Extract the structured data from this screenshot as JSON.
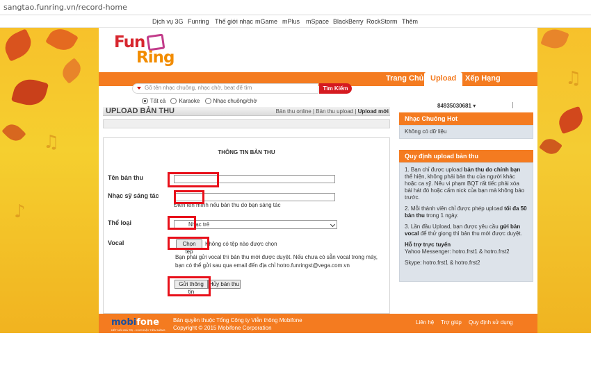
{
  "browser": {
    "url": "sangtao.funring.vn/record-home"
  },
  "topnav": [
    "Dịch vụ 3G",
    "Funring",
    "Thế giới nhạc",
    "mGame",
    "mPlus",
    "mSpace",
    "BlackBerry",
    "RockStorm",
    "Thêm"
  ],
  "logo": {
    "part1": "Fun",
    "part2": "Ring"
  },
  "tabs": {
    "home": "Trang Chủ",
    "upload": "Upload",
    "ranking": "Xếp Hạng"
  },
  "search": {
    "placeholder": "Gõ tên nhạc chuông, nhạc chờ, beat để tìm",
    "button": "Tìm Kiếm"
  },
  "search_filters": {
    "all": "Tất cả",
    "karaoke": "Karaoke",
    "ringtone": "Nhạc chuông/chờ"
  },
  "section": {
    "title": "UPLOAD BẢN THU",
    "links": {
      "online": "Bản thu online",
      "uploaded": "Bản thu upload",
      "newest": "Upload mới"
    },
    "separator": " | "
  },
  "form": {
    "heading": "THÔNG TIN BẢN THU",
    "title_label": "Tên bản thu",
    "composer_label": "Nhạc sỹ sáng tác",
    "composer_hint": "Điền tên mình nếu bản thu do bạn sáng tác",
    "genre_label": "Thể loại",
    "genre_value": "Nhạc trẻ",
    "vocal_label": "Vocal",
    "file_button": "Chọn tệp",
    "file_status": "Không có tệp nào được chọn",
    "notice": "Bạn phải gửi vocal thì bản thu mới được duyệt. Nếu chưa có sẵn vocal trong máy, bạn có thể gửi sau qua email đến địa chỉ hotro.funringst@vega.com.vn",
    "submit_button": "Gửi thông tin",
    "cancel_button": "Hủy bản thu"
  },
  "account": {
    "phone": "84935030681"
  },
  "hot_ringtones": {
    "title": "Nhạc Chuông Hot",
    "empty": "Không có dữ liệu"
  },
  "rules": {
    "title": "Quy định upload bản thu",
    "rule1_a": "1. Bạn chỉ được upload ",
    "rule1_b": "bản thu do chính bạn",
    "rule1_c": " thể hiện, không phải bản thu của người khác hoặc ca sỹ. Nếu vi phạm BQT rất tiếc phải xóa bài hát đó hoặc cấm nick của bạn mà không báo trước.",
    "rule2_a": "2. Mỗi thành viên chỉ được phép upload ",
    "rule2_b": "tối đa 50 bản thu",
    "rule2_c": " trong 1 ngày.",
    "rule3_a": "3. Lần đầu Upload, bạn được yêu cầu ",
    "rule3_b": "gửi bản vocal",
    "rule3_c": " để thử giọng thì bản thu mới được duyệt.",
    "support_title": "Hỗ trợ trực tuyến",
    "support_yahoo": "Yahoo Messenger: hotro.frst1 & hotro.frst2",
    "support_skype": "Skype: hotro.frst1 & hotro.frst2"
  },
  "footer": {
    "logo_mo": "mobi",
    "logo_fone": "fone",
    "tagline": "KẾT NỐI GIÁ TRỊ - KHƠI DẬY TIỀM NĂNG",
    "copyright1": "Bản quyền thuộc Tổng Công ty Viễn thông Mobifone",
    "copyright2": "Copyright © 2015 Mobifone Corporation",
    "links": [
      "Liên hệ",
      "Trợ giúp",
      "Quy định sử dụng"
    ]
  },
  "colors": {
    "orange": "#f47b20",
    "highlight": "#e8101a",
    "search_button": "#d51a20"
  }
}
